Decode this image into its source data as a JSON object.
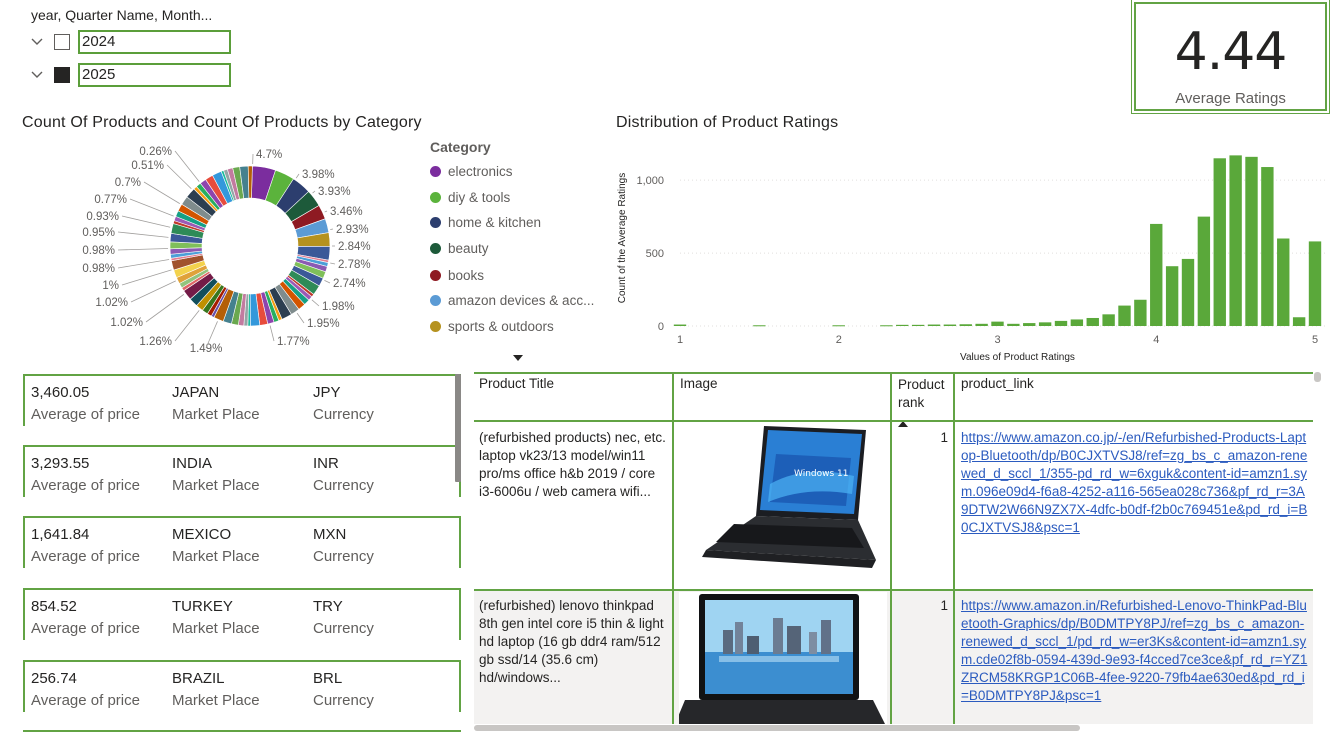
{
  "slicer": {
    "title": "year, Quarter Name, Month...",
    "items": [
      {
        "label": "2024",
        "checked": false
      },
      {
        "label": "2025",
        "checked": true
      }
    ]
  },
  "kpi": {
    "value": "4.44",
    "label": "Average Ratings"
  },
  "donut": {
    "title": "Count Of Products and Count Of Products by Category",
    "legend_title": "Category",
    "legend": [
      {
        "label": "electronics",
        "color": "#7b2d9e"
      },
      {
        "label": "diy & tools",
        "color": "#5bb33c"
      },
      {
        "label": "home & kitchen",
        "color": "#2c3e6e"
      },
      {
        "label": "beauty",
        "color": "#1d5a3a"
      },
      {
        "label": "books",
        "color": "#8e1a22"
      },
      {
        "label": "amazon devices & acc...",
        "color": "#5b9bd5"
      },
      {
        "label": "sports & outdoors",
        "color": "#b5921f"
      }
    ],
    "labels": [
      "0.26%",
      "4.7%",
      "3.98%",
      "3.93%",
      "3.46%",
      "2.93%",
      "2.84%",
      "2.78%",
      "2.74%",
      "1.98%",
      "1.95%",
      "1.77%",
      "1.49%",
      "1.26%",
      "1.02%",
      "1.02%",
      "1%",
      "0.98%",
      "0.98%",
      "0.95%",
      "0.93%",
      "0.77%",
      "0.7%",
      "0.51%"
    ]
  },
  "histogram": {
    "title": "Distribution of Product Ratings",
    "xlabel": "Values of Product Ratings",
    "ylabel": "Count of the Average Ratings",
    "x_ticks": [
      "1",
      "2",
      "3",
      "4",
      "5"
    ],
    "y_ticks": [
      "0",
      "500",
      "1,000"
    ]
  },
  "chart_data": {
    "type": "bar",
    "title": "Distribution of Product Ratings",
    "xlabel": "Values of Product Ratings",
    "ylabel": "Count of the Average Ratings",
    "xlim": [
      1,
      5
    ],
    "ylim": [
      0,
      1200
    ],
    "color": "#5aa83a",
    "x": [
      1.0,
      1.5,
      2.0,
      2.3,
      2.4,
      2.5,
      2.6,
      2.7,
      2.8,
      2.9,
      3.0,
      3.1,
      3.2,
      3.3,
      3.4,
      3.5,
      3.6,
      3.7,
      3.8,
      3.9,
      4.0,
      4.1,
      4.2,
      4.3,
      4.4,
      4.5,
      4.6,
      4.7,
      4.8,
      4.9,
      5.0
    ],
    "values": [
      10,
      5,
      5,
      5,
      8,
      8,
      10,
      10,
      12,
      15,
      30,
      15,
      20,
      25,
      35,
      45,
      55,
      80,
      140,
      180,
      700,
      410,
      460,
      750,
      1150,
      1170,
      1160,
      1090,
      600,
      60,
      580
    ]
  },
  "country_cards": [
    {
      "value": "3,460.05",
      "value_label": "Average of price",
      "country": "JAPAN",
      "country_label": "Market Place",
      "currency": "JPY",
      "currency_label": "Currency"
    },
    {
      "value": "3,293.55",
      "value_label": "Average of price",
      "country": "INDIA",
      "country_label": "Market Place",
      "currency": "INR",
      "currency_label": "Currency"
    },
    {
      "value": "1,641.84",
      "value_label": "Average of price",
      "country": "MEXICO",
      "country_label": "Market Place",
      "currency": "MXN",
      "currency_label": "Currency"
    },
    {
      "value": "854.52",
      "value_label": "Average of price",
      "country": "TURKEY",
      "country_label": "Market Place",
      "currency": "TRY",
      "currency_label": "Currency"
    },
    {
      "value": "256.74",
      "value_label": "Average of price",
      "country": "BRAZIL",
      "country_label": "Market Place",
      "currency": "BRL",
      "currency_label": "Currency"
    }
  ],
  "table": {
    "columns": [
      "Product Title",
      "Image",
      "Product rank",
      "product_link"
    ],
    "rows": [
      {
        "title": "(refurbished products) nec, etc. laptop vk23/13 model/win11 pro/ms office h&b 2019 / core i3-6006u / web camera wifi...",
        "rank": "1",
        "link": "https://www.amazon.co.jp/-/en/Refurbished-Products-Laptop-Bluetooth/dp/B0CJXTVSJ8/ref=zg_bs_c_amazon-renewed_d_sccl_1/355-pd_rd_w=6xguk&content-id=amzn1.sym.096e09d4-f6a8-4252-a116-565ea028c736&pf_rd_r=3A9DTW2W66N9ZX7X-4dfc-b0df-f2b0c769451e&pd_rd_i=B0CJXTVSJ8&psc=1"
      },
      {
        "title": "(refurbished) lenovo thinkpad 8th gen intel core i5 thin & light hd laptop (16 gb ddr4 ram/512 gb ssd/14 (35.6 cm) hd/windows...",
        "rank": "1",
        "link": "https://www.amazon.in/Refurbished-Lenovo-ThinkPad-Bluetooth-Graphics/dp/B0DMTPY8PJ/ref=zg_bs_c_amazon-renewed_d_sccl_1/pd_rd_w=er3Ks&content-id=amzn1.sym.cde02f8b-0594-439d-9e93-f4cced7ce3ce&pf_rd_r=YZ1ZRCM58KRGP1C06B-4fee-9220-79fb4ae630ed&pd_rd_i=B0DMTPY8PJ&psc=1"
      }
    ]
  }
}
